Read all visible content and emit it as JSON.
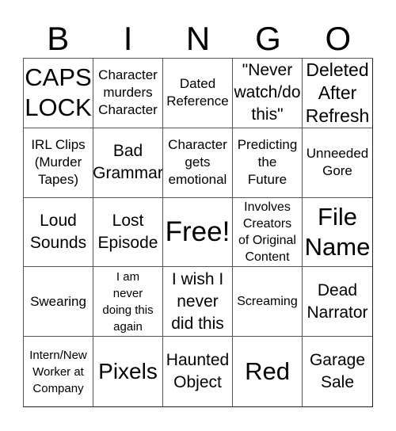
{
  "header": [
    "B",
    "I",
    "N",
    "G",
    "O"
  ],
  "cells": [
    {
      "text": "CAPS\nLOCK",
      "size": "s6"
    },
    {
      "text": "Character\nmurders\nCharacter",
      "size": "s2"
    },
    {
      "text": "Dated\nReference",
      "size": "s2"
    },
    {
      "text": "\"Never\nwatch/do\nthis\"",
      "size": "s3"
    },
    {
      "text": "Deleted\nAfter\nRefresh",
      "size": "s4"
    },
    {
      "text": "IRL Clips\n(Murder\nTapes)",
      "size": "s2"
    },
    {
      "text": "Bad\nGrammar",
      "size": "s3"
    },
    {
      "text": "Character\ngets\nemotional",
      "size": "s2"
    },
    {
      "text": "Predicting\nthe\nFuture",
      "size": "s2"
    },
    {
      "text": "Unneeded\nGore",
      "size": "s2"
    },
    {
      "text": "Loud\nSounds",
      "size": "s3"
    },
    {
      "text": "Lost\nEpisode",
      "size": "s3"
    },
    {
      "text": "Free!",
      "size": "s7"
    },
    {
      "text": "Involves\nCreators\nof Original\nContent",
      "size": "s1"
    },
    {
      "text": "File\nName",
      "size": "s6"
    },
    {
      "text": "Swearing",
      "size": "s2"
    },
    {
      "text": "I am\nnever\ndoing this\nagain",
      "size": "s0"
    },
    {
      "text": "I wish I\nnever\ndid this",
      "size": "s3"
    },
    {
      "text": "Screaming",
      "size": "s1"
    },
    {
      "text": "Dead\nNarrator",
      "size": "s3"
    },
    {
      "text": "Intern/New\nWorker at\nCompany",
      "size": "s0"
    },
    {
      "text": "Pixels",
      "size": "s5"
    },
    {
      "text": "Haunted\nObject",
      "size": "s3"
    },
    {
      "text": "Red",
      "size": "s6"
    },
    {
      "text": "Garage\nSale",
      "size": "s3"
    }
  ]
}
